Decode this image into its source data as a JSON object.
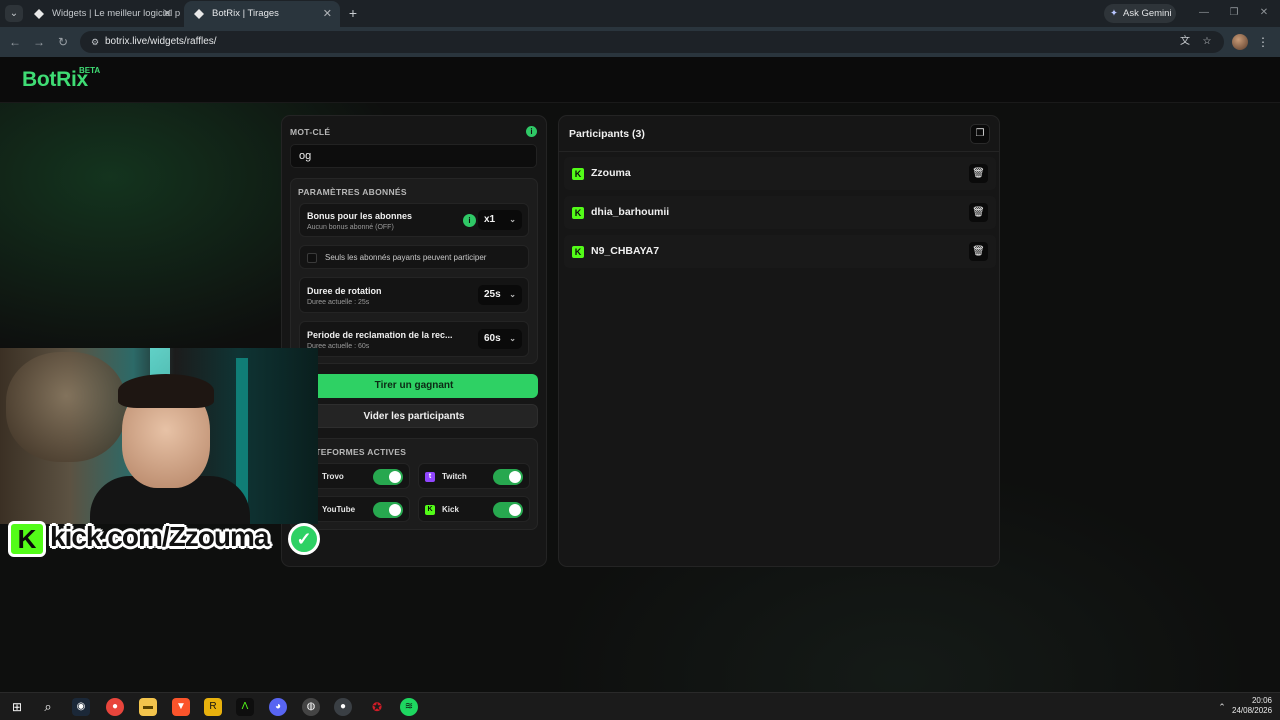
{
  "browser": {
    "tabs": [
      {
        "title": "Widgets | Le meilleur logiciel p",
        "active": false
      },
      {
        "title": "BotRix | Tirages",
        "active": true
      }
    ],
    "new_tab_label": "+",
    "gemini_label": "Ask Gemini",
    "url": "botrix.live/widgets/raffles/"
  },
  "app": {
    "logo": "BotRix",
    "logo_badge": "BETA",
    "accent_color": "#2ed164"
  },
  "raffle": {
    "keyword_label": "MOT-CLÉ",
    "keyword_value": "og",
    "sub_section_label": "PARAMÈTRES ABONNÉS",
    "bonus": {
      "title": "Bonus pour les abonnes",
      "subtitle": "Aucun bonus abonné (OFF)",
      "value": "x1"
    },
    "paid_only_label": "Seuls les abonnés payants peuvent participer",
    "paid_only_checked": false,
    "rotation": {
      "title": "Duree de rotation",
      "subtitle": "Duree actuelle : 25s",
      "value": "25s"
    },
    "claim": {
      "title": "Periode de reclamation de la rec...",
      "subtitle": "Duree actuelle : 60s",
      "value": "60s"
    },
    "draw_button": "Tirer un gagnant",
    "clear_button": "Vider les participants",
    "platforms_label": "PLATEFORMES ACTIVES",
    "platforms": [
      {
        "name": "Trovo",
        "enabled": true,
        "icon": "trovo-icon",
        "color": "#1fd67a"
      },
      {
        "name": "Twitch",
        "enabled": true,
        "icon": "twitch-icon",
        "color": "#9146ff"
      },
      {
        "name": "YouTube",
        "enabled": true,
        "icon": "youtube-icon",
        "color": "#ff0000"
      },
      {
        "name": "Kick",
        "enabled": true,
        "icon": "kick-icon",
        "color": "#53fc18"
      }
    ]
  },
  "participants": {
    "title": "Participants (3)",
    "list": [
      {
        "name": "Zzouma",
        "platform": "kick"
      },
      {
        "name": "dhia_barhoumii",
        "platform": "kick"
      },
      {
        "name": "N9_CHBAYA7",
        "platform": "kick"
      }
    ]
  },
  "overlay": {
    "kick_url": "kick.com/Zzouma"
  },
  "taskbar": {
    "time": "20:06",
    "date": "24/08/2026"
  }
}
